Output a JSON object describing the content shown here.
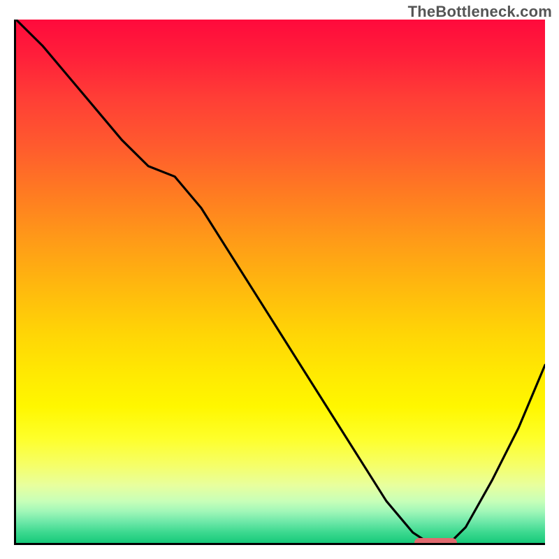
{
  "watermark": "TheBottleneck.com",
  "colors": {
    "frame": "#000000",
    "curve": "#000000",
    "marker": "#e06a6f",
    "gradient_top": "#ff0a3c",
    "gradient_mid": "#ffea02",
    "gradient_bottom": "#17c97a"
  },
  "chart_data": {
    "type": "line",
    "title": "",
    "xlabel": "",
    "ylabel": "",
    "xlim": [
      0,
      100
    ],
    "ylim": [
      0,
      100
    ],
    "grid": false,
    "legend": false,
    "series": [
      {
        "name": "bottleneck-curve",
        "x": [
          0,
          5,
          10,
          15,
          20,
          25,
          30,
          35,
          40,
          45,
          50,
          55,
          60,
          65,
          70,
          75,
          78,
          82,
          85,
          90,
          95,
          100
        ],
        "y": [
          100,
          95,
          89,
          83,
          77,
          72,
          70,
          64,
          56,
          48,
          40,
          32,
          24,
          16,
          8,
          2,
          0,
          0,
          3,
          12,
          22,
          34
        ]
      }
    ],
    "annotations": [
      {
        "name": "optimal-marker",
        "x_start": 75,
        "x_end": 83,
        "y": 0
      }
    ],
    "gradient_bands": [
      {
        "y": 100,
        "color": "#ff0a3c"
      },
      {
        "y": 68,
        "color": "#ffea02"
      },
      {
        "y": 0,
        "color": "#17c97a"
      }
    ]
  }
}
